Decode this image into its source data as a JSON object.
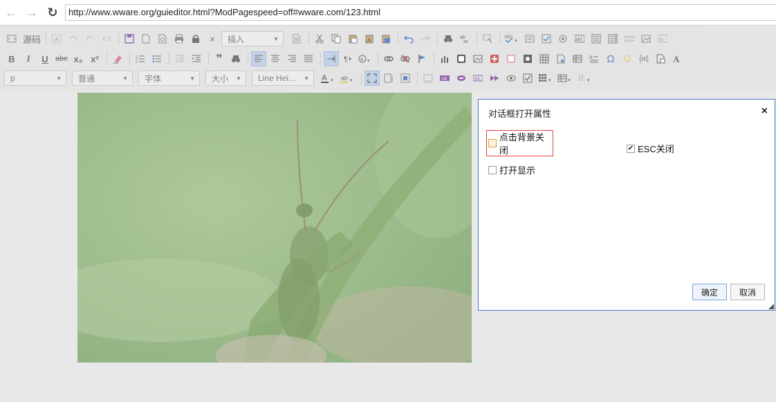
{
  "browser": {
    "url": "http://www.wware.org/guieditor.html?ModPagespeed=off#wware.com/123.html",
    "back_icon": "←",
    "forward_icon": "→",
    "reload_icon": "↻"
  },
  "toolbar": {
    "source_label": "源码",
    "insert_combo": "插入",
    "row3": {
      "paragraph": "p",
      "style": "普通",
      "font": "字体",
      "size": "大小",
      "line_height": "Line Hei..."
    },
    "glyphs": {
      "bold": "B",
      "italic": "I",
      "underline": "U",
      "strike": "abc",
      "subscript": "x₂",
      "superscript": "x²",
      "omega": "Ω",
      "smiley": "☺",
      "quote": "❞",
      "close": "×"
    }
  },
  "dialog": {
    "title": "对话框打开属性",
    "close_icon": "×",
    "options": {
      "click_bg_close": {
        "label": "点击背景关闭",
        "checked": false
      },
      "esc_close": {
        "label": "ESC关闭",
        "checked": true
      },
      "open_show": {
        "label": "打开显示",
        "checked": false
      }
    },
    "ok_label": "确定",
    "cancel_label": "取消",
    "check_mark": "✔"
  },
  "colors": {
    "dialog_border": "#4a7cc0",
    "highlight_border": "#e04040",
    "overlay": "#e8e8e8"
  }
}
